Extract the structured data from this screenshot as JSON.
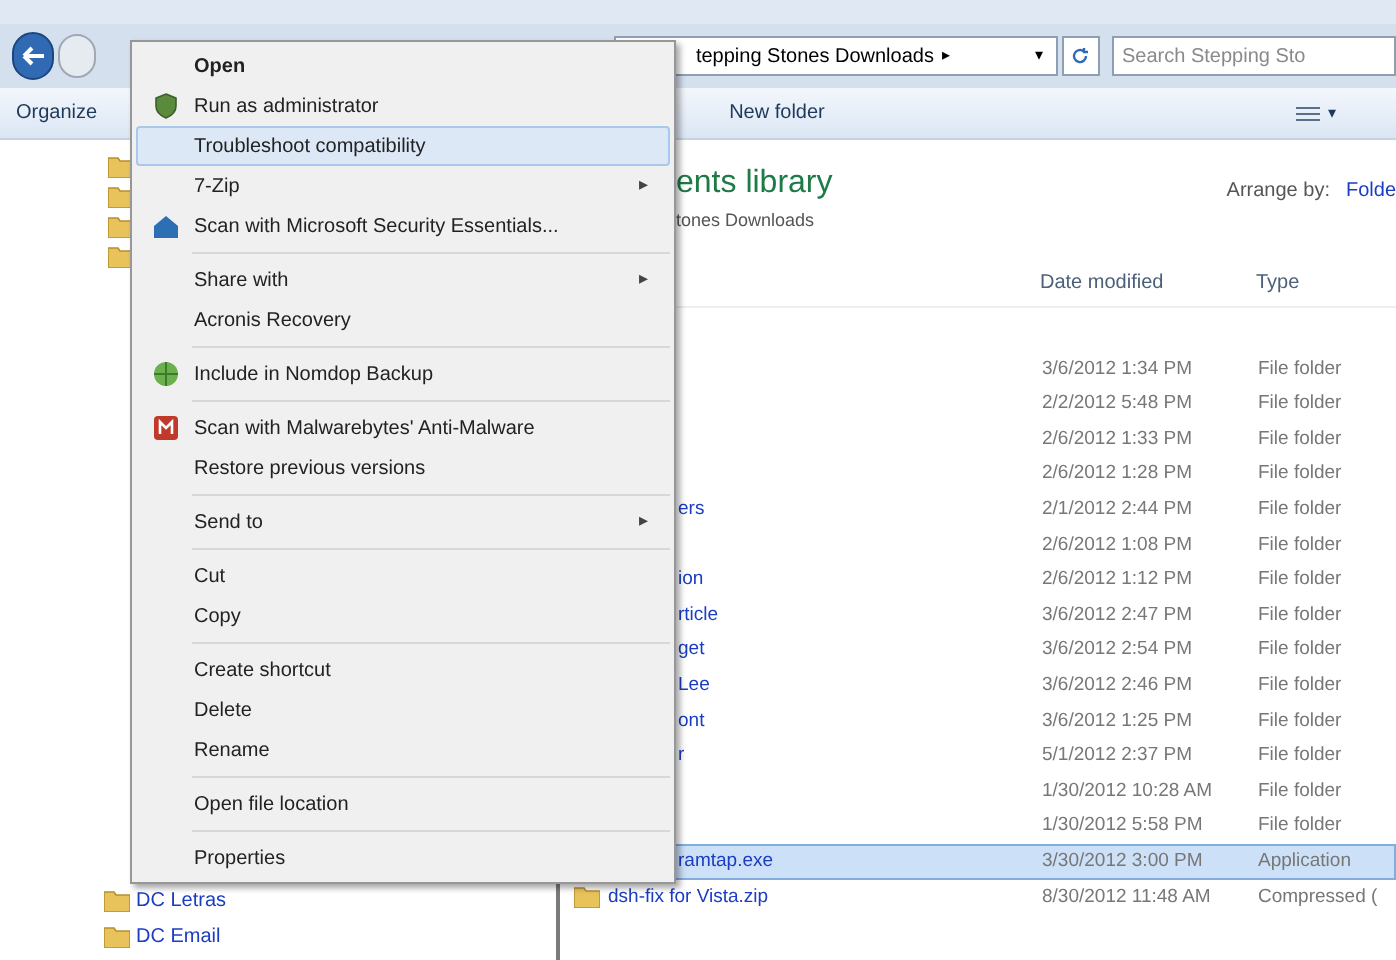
{
  "address_bar": {
    "path": "tepping Stones Downloads",
    "arrow": "▸",
    "caret": "▾"
  },
  "search": {
    "placeholder": "Search Stepping Sto"
  },
  "toolbar": {
    "items": [
      "Organize",
      "New folder"
    ],
    "views_caret": "▾"
  },
  "library": {
    "title": "ents library",
    "subtitle": "tones Downloads",
    "arrange_label": "Arrange by:",
    "arrange_value": "Folde"
  },
  "columns": [
    "Date modified",
    "Type"
  ],
  "rows": [
    {
      "kind": "covered",
      "date": "3/6/2012 1:34 PM",
      "type": "File folder",
      "selected": false
    },
    {
      "kind": "covered",
      "date": "2/2/2012 5:48 PM",
      "type": "File folder",
      "selected": false
    },
    {
      "kind": "covered",
      "date": "2/6/2012 1:33 PM",
      "type": "File folder",
      "selected": false
    },
    {
      "kind": "covered",
      "date": "2/6/2012 1:28 PM",
      "type": "File folder",
      "selected": false
    },
    {
      "kind": "covered",
      "name": "ers",
      "date": "2/1/2012 2:44 PM",
      "type": "File folder",
      "selected": false
    },
    {
      "kind": "covered",
      "date": "2/6/2012 1:08 PM",
      "type": "File folder",
      "selected": false
    },
    {
      "kind": "covered",
      "name": "ion",
      "date": "2/6/2012 1:12 PM",
      "type": "File folder",
      "selected": false
    },
    {
      "kind": "covered",
      "name": "rticle",
      "date": "3/6/2012 2:47 PM",
      "type": "File folder",
      "selected": false
    },
    {
      "kind": "covered",
      "name": "get",
      "date": "3/6/2012 2:54 PM",
      "type": "File folder",
      "selected": false
    },
    {
      "kind": "covered",
      "name": "Lee",
      "date": "3/6/2012 2:46 PM",
      "type": "File folder",
      "selected": false
    },
    {
      "kind": "covered",
      "name": "ont",
      "date": "3/6/2012 1:25 PM",
      "type": "File folder",
      "selected": false
    },
    {
      "kind": "covered",
      "name": "r",
      "date": "5/1/2012 2:37 PM",
      "type": "File folder",
      "selected": false
    },
    {
      "kind": "covered",
      "date": "1/30/2012 10:28 AM",
      "type": "File folder",
      "selected": false
    },
    {
      "kind": "covered",
      "date": "1/30/2012 5:58 PM",
      "type": "File folder",
      "selected": false
    },
    {
      "kind": "covered",
      "name": "ramtap.exe",
      "date": "3/30/2012 3:00 PM",
      "type": "Application",
      "selected": true
    },
    {
      "kind": "full",
      "name": "dsh-fix for Vista.zip",
      "date": "8/30/2012 11:48 AM",
      "type": "Compressed (",
      "selected": false
    }
  ],
  "sidebar": {
    "items": [
      "DC Letras",
      "DC Email"
    ]
  },
  "context_menu": [
    {
      "kind": "item",
      "label": "Open",
      "default": true,
      "submenu": false,
      "selected": false
    },
    {
      "kind": "item",
      "label": "Run as administrator",
      "default": false,
      "submenu": false,
      "selected": false
    },
    {
      "kind": "item",
      "label": "Troubleshoot compatibility",
      "default": false,
      "submenu": false,
      "selected": true
    },
    {
      "kind": "item",
      "label": "7-Zip",
      "default": false,
      "submenu": true,
      "selected": false
    },
    {
      "kind": "item",
      "label": "Scan with Microsoft Security Essentials...",
      "default": false,
      "submenu": false,
      "selected": false
    },
    {
      "kind": "separator"
    },
    {
      "kind": "item",
      "label": "Share with",
      "default": false,
      "submenu": true,
      "selected": false
    },
    {
      "kind": "item",
      "label": "Acronis Recovery",
      "default": false,
      "submenu": false,
      "selected": false
    },
    {
      "kind": "separator"
    },
    {
      "kind": "item",
      "label": "Include in Nomdop Backup",
      "default": false,
      "submenu": false,
      "selected": false
    },
    {
      "kind": "separator"
    },
    {
      "kind": "item",
      "label": "Scan with Malwarebytes' Anti-Malware",
      "default": false,
      "submenu": false,
      "selected": false
    },
    {
      "kind": "item",
      "label": "Restore previous versions",
      "default": false,
      "submenu": false,
      "selected": false
    },
    {
      "kind": "separator"
    },
    {
      "kind": "item",
      "label": "Send to",
      "default": false,
      "submenu": true,
      "selected": false
    },
    {
      "kind": "separator"
    },
    {
      "kind": "item",
      "label": "Cut",
      "default": false,
      "submenu": false,
      "selected": false
    },
    {
      "kind": "item",
      "label": "Copy",
      "default": false,
      "submenu": false,
      "selected": false
    },
    {
      "kind": "separator"
    },
    {
      "kind": "item",
      "label": "Create shortcut",
      "default": false,
      "submenu": false,
      "selected": false
    },
    {
      "kind": "item",
      "label": "Delete",
      "default": false,
      "submenu": false,
      "selected": false
    },
    {
      "kind": "item",
      "label": "Rename",
      "default": false,
      "submenu": false,
      "selected": false
    },
    {
      "kind": "separator"
    },
    {
      "kind": "item",
      "label": "Open file location",
      "default": false,
      "submenu": false,
      "selected": false
    },
    {
      "kind": "separator"
    },
    {
      "kind": "item",
      "label": "Properties",
      "default": false,
      "submenu": false,
      "selected": false
    }
  ],
  "submenu_arrow": "▸"
}
